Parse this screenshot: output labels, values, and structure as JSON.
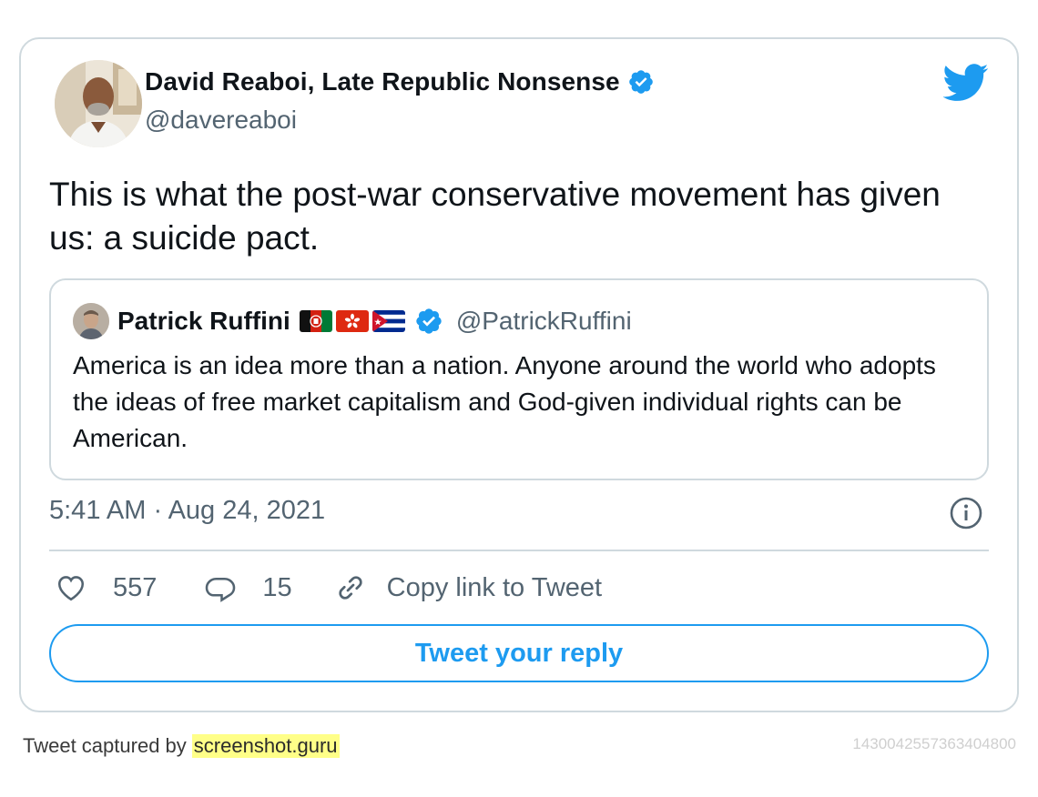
{
  "author": {
    "display_name": "David Reaboi, Late Republic Nonsense",
    "handle": "@davereaboi",
    "verified": true
  },
  "tweet": {
    "text": "This is what the post-war conservative movement has given us: a suicide pact."
  },
  "quoted_tweet": {
    "display_name": "Patrick Ruffini",
    "flags": [
      "afghanistan-flag",
      "hong-kong-flag",
      "cuba-flag"
    ],
    "verified": true,
    "handle": "@PatrickRuffini",
    "text": "America is an idea more than a nation. Anyone around the world who adopts the ideas of free market capitalism and God-given individual rights can be American."
  },
  "meta": {
    "timestamp": "5:41 AM · Aug 24, 2021"
  },
  "actions": {
    "likes": "557",
    "replies": "15",
    "copy_link_label": "Copy link to Tweet"
  },
  "reply_button": {
    "label": "Tweet your reply"
  },
  "footer": {
    "captured_prefix": "Tweet captured by",
    "captured_site": "screenshot.guru",
    "tweet_id": "1430042557363404800"
  },
  "colors": {
    "accent": "#1d9bf0",
    "secondary_text": "#536471",
    "border": "#cfd9de"
  }
}
